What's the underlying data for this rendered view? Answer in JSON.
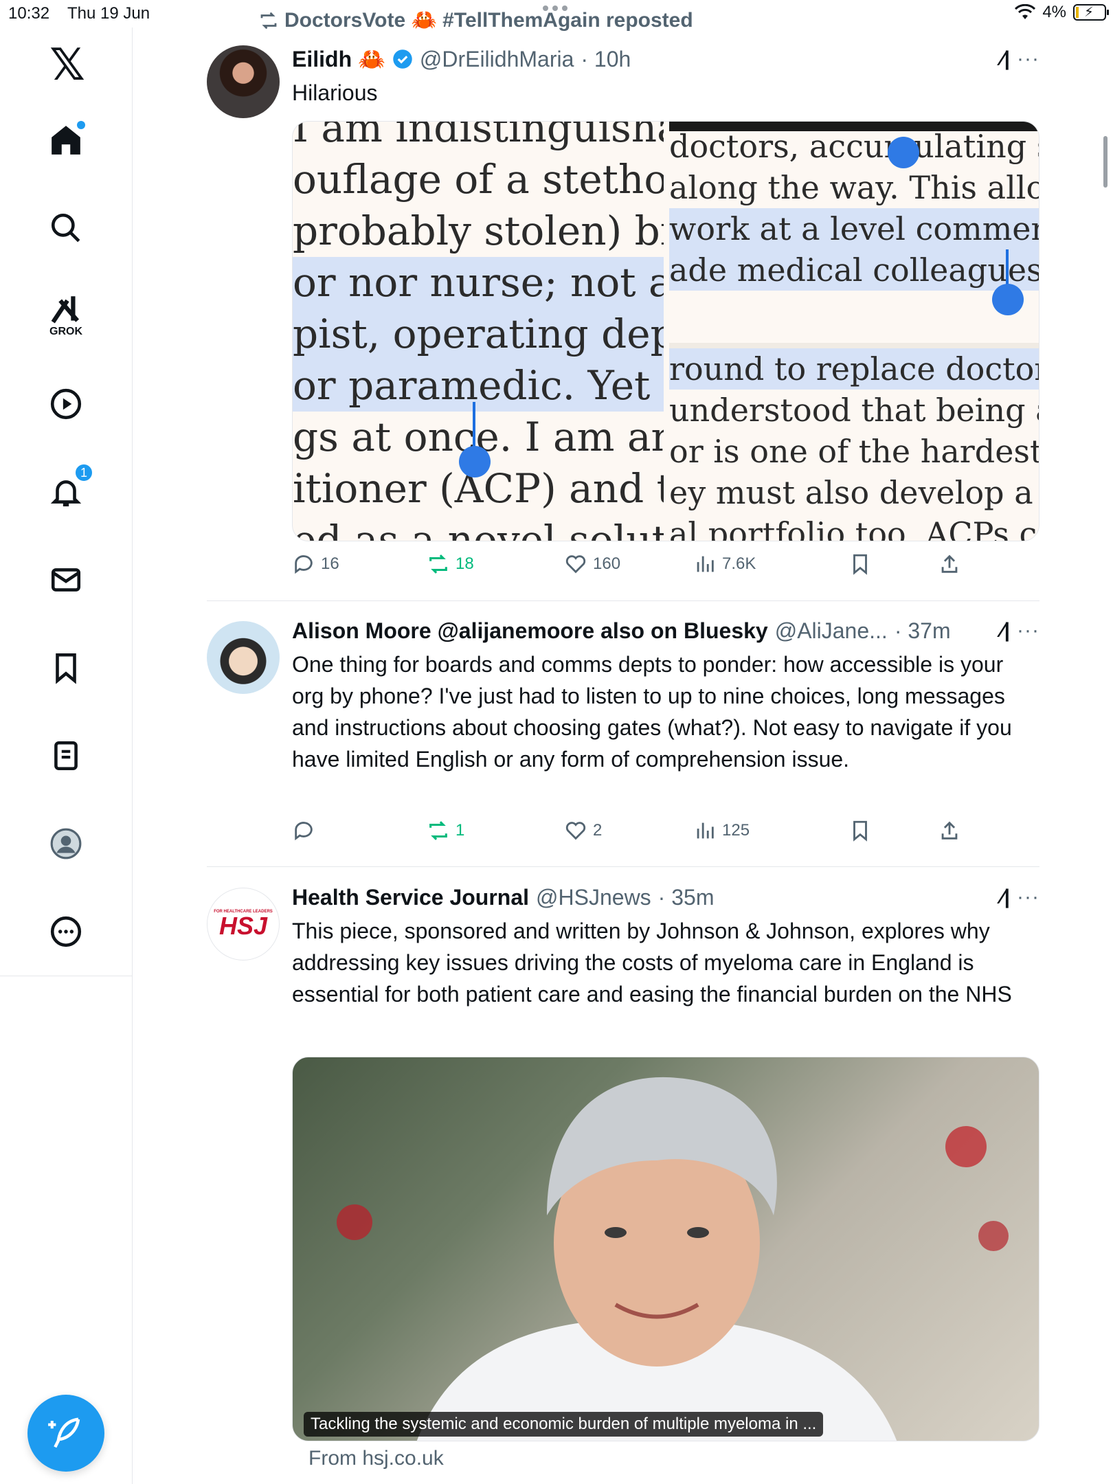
{
  "status": {
    "time": "10:32",
    "date": "Thu 19 Jun",
    "battery": "4%"
  },
  "sidebar": {
    "grok_label": "GROK",
    "notifications_badge": "1"
  },
  "repost": {
    "text": "DoctorsVote 🦀 #TellThemAgain reposted"
  },
  "tweets": [
    {
      "name": "Eilidh 🦀",
      "handle": "@DrEilidhMaria",
      "time": "· 10h",
      "text": "Hilarious",
      "stats": {
        "replies": "16",
        "reposts": "18",
        "likes": "160",
        "views": "7.6K"
      },
      "media_left_lines": [
        "I am indistinguishabl",
        "ouflage of a stethosco",
        "probably stolen) biro.",
        "or nor nurse; not a",
        "pist, operating depart",
        "or paramedic. Yet my",
        "gs at once. I am an ac",
        "itioner (ACP) and the",
        "ed as a novel solutio"
      ],
      "media_right_lines_top": [
        "doctors, accumulating sl",
        "along the way. This allov",
        "work at a level commens",
        "ade medical colleagues."
      ],
      "media_right_lines_bottom": [
        "round to replace doctors",
        "understood that being a n",
        "or is one of the hardest jo",
        "ey must also develop a le",
        "al portfolio too. ACPs ca"
      ]
    },
    {
      "name": "Alison Moore @alijanemoore also on Bluesky",
      "handle": "@AliJane...",
      "time": "· 37m",
      "text": "One thing for boards and comms depts to ponder: how accessible is your org by phone? I've just had to listen to up to nine choices, long messages and instructions about choosing gates (what?).  Not easy to navigate if you have limited English or any form of comprehension issue.",
      "stats": {
        "replies": "",
        "reposts": "1",
        "likes": "2",
        "views": "125"
      }
    },
    {
      "name": "Health Service Journal",
      "handle": "@HSJnews",
      "time": "· 35m",
      "text": "This piece, sponsored and written by Johnson & Johnson, explores why addressing key issues driving the costs of myeloma care in England is essential for both patient care and easing the financial burden on the NHS",
      "avatar_text": "HSJ",
      "avatar_small": "FOR HEALTHCARE LEADERS",
      "card_caption": "Tackling the systemic and economic burden of multiple myeloma in ...",
      "card_source": "From hsj.co.uk"
    }
  ]
}
